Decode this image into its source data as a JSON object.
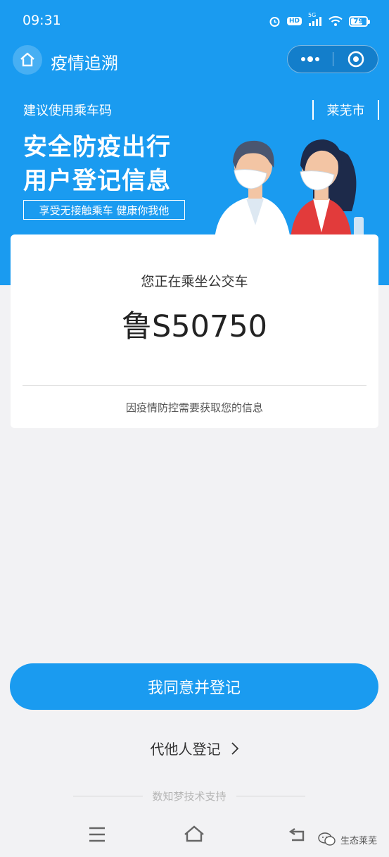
{
  "status_bar": {
    "time": "09:31",
    "network": "5G",
    "hd_badge": "HD",
    "battery": "79",
    "battery_level": 0.79
  },
  "nav": {
    "title": "疫情追溯"
  },
  "banner": {
    "subtitle": "建议使用乘车码",
    "city": "莱芜市",
    "title_line1": "安全防疫出行",
    "title_line2": "用户登记信息",
    "slogan": "享受无接触乘车 健康你我他"
  },
  "card": {
    "riding_label": "您正在乘坐公交车",
    "plate": "鲁S50750",
    "notice": "因疫情防控需要获取您的信息"
  },
  "actions": {
    "agree_label": "我同意并登记",
    "proxy_label": "代他人登记",
    "support_text": "数知梦技术支持"
  },
  "watermark": {
    "text": "生态莱芜"
  },
  "colors": {
    "primary": "#1a9bf0",
    "background": "#f2f2f4"
  }
}
